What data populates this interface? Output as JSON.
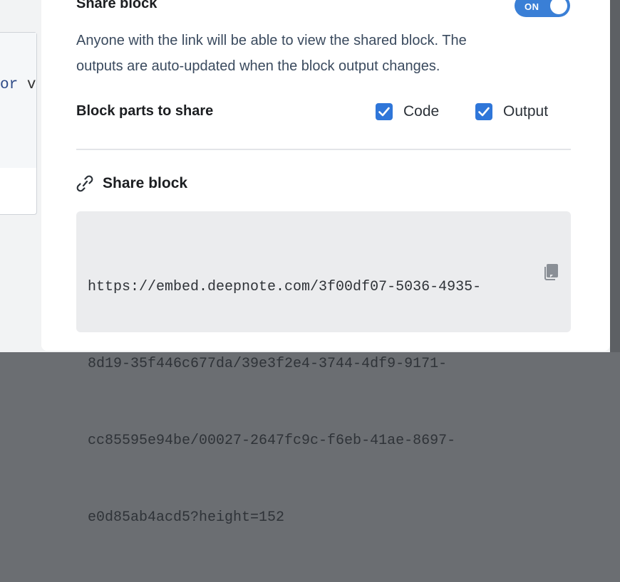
{
  "background": {
    "code_keyword": "or",
    "code_rest": " v"
  },
  "modal": {
    "section_title": "Share block",
    "toggle_label": "ON",
    "description_line1": "Anyone with the link will be able to view the shared block. The",
    "description_line2": "outputs are auto-updated when the block output changes.",
    "parts_label": "Block parts to share",
    "checkboxes": [
      {
        "label": "Code",
        "checked": true
      },
      {
        "label": "Output",
        "checked": true
      }
    ],
    "share_title": "Share block",
    "url_lines": [
      "https://embed.deepnote.com/3f00df07-5036-4935-",
      "8d19-35f446c677da/39e3f2e4-3744-4df9-9171-",
      "cc85595e94be/00027-2647fc9c-f6eb-41ae-8697-",
      "e0d85ab4acd5?height=152"
    ]
  },
  "colors": {
    "accent": "#2f76d9",
    "toggle_on": "#3a7fd6"
  },
  "icons": {
    "link": "link-icon",
    "copy": "copy-icon",
    "check": "checkmark-icon"
  }
}
